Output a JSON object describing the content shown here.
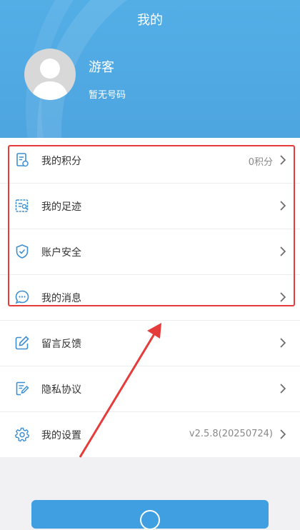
{
  "header": {
    "title": "我的",
    "user_name": "游客",
    "user_phone": "暂无号码",
    "color": "#4fa9e3"
  },
  "menu": {
    "items": [
      {
        "label": "我的积分",
        "value": "0积分",
        "icon": "points-doc-icon"
      },
      {
        "label": "我的足迹",
        "value": "",
        "icon": "footprint-list-icon"
      },
      {
        "label": "账户安全",
        "value": "",
        "icon": "shield-check-icon"
      },
      {
        "label": "我的消息",
        "value": "",
        "icon": "message-bubble-icon"
      },
      {
        "label": "留言反馈",
        "value": "",
        "icon": "edit-pen-icon"
      },
      {
        "label": "隐私协议",
        "value": "",
        "icon": "privacy-doc-icon"
      },
      {
        "label": "我的设置",
        "value": "v2.5.8(20250724)",
        "icon": "gear-icon"
      }
    ]
  },
  "colors": {
    "accent": "#3f9fe0",
    "icon": "#3d8fd4",
    "annotation": "#e53b3b"
  }
}
